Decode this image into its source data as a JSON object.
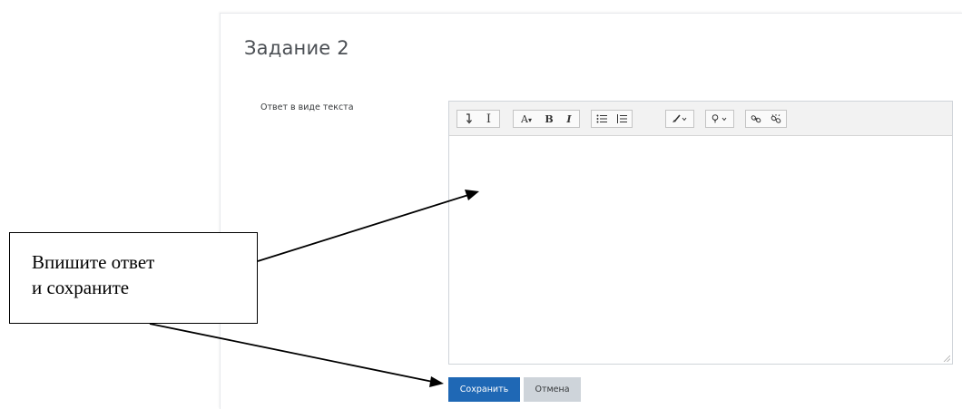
{
  "page": {
    "title": "Задание 2",
    "field_label": "Ответ в виде текста"
  },
  "toolbar": {
    "groups": [
      {
        "items": [
          {
            "icon": "collapse-toolbar-icon"
          },
          {
            "icon": "text-cursor-icon",
            "glyph": "I"
          }
        ]
      },
      {
        "items": [
          {
            "icon": "paragraph-style-icon",
            "glyph": "A▾"
          },
          {
            "icon": "bold-icon",
            "glyph": "B"
          },
          {
            "icon": "italic-icon",
            "glyph": "I"
          }
        ]
      },
      {
        "items": [
          {
            "icon": "bullet-list-icon"
          },
          {
            "icon": "numbered-list-icon"
          }
        ]
      },
      {
        "items": [
          {
            "icon": "brush-icon"
          }
        ]
      },
      {
        "items": [
          {
            "icon": "lightbulb-icon"
          }
        ]
      },
      {
        "items": [
          {
            "icon": "link-icon"
          },
          {
            "icon": "unlink-icon"
          }
        ]
      }
    ]
  },
  "buttons": {
    "save_label": "Сохранить",
    "cancel_label": "Отмена"
  },
  "callout": {
    "line1": "Впишите ответ",
    "line2": "и сохраните"
  },
  "colors": {
    "primary": "#1f68b5",
    "secondary": "#ced4da"
  }
}
